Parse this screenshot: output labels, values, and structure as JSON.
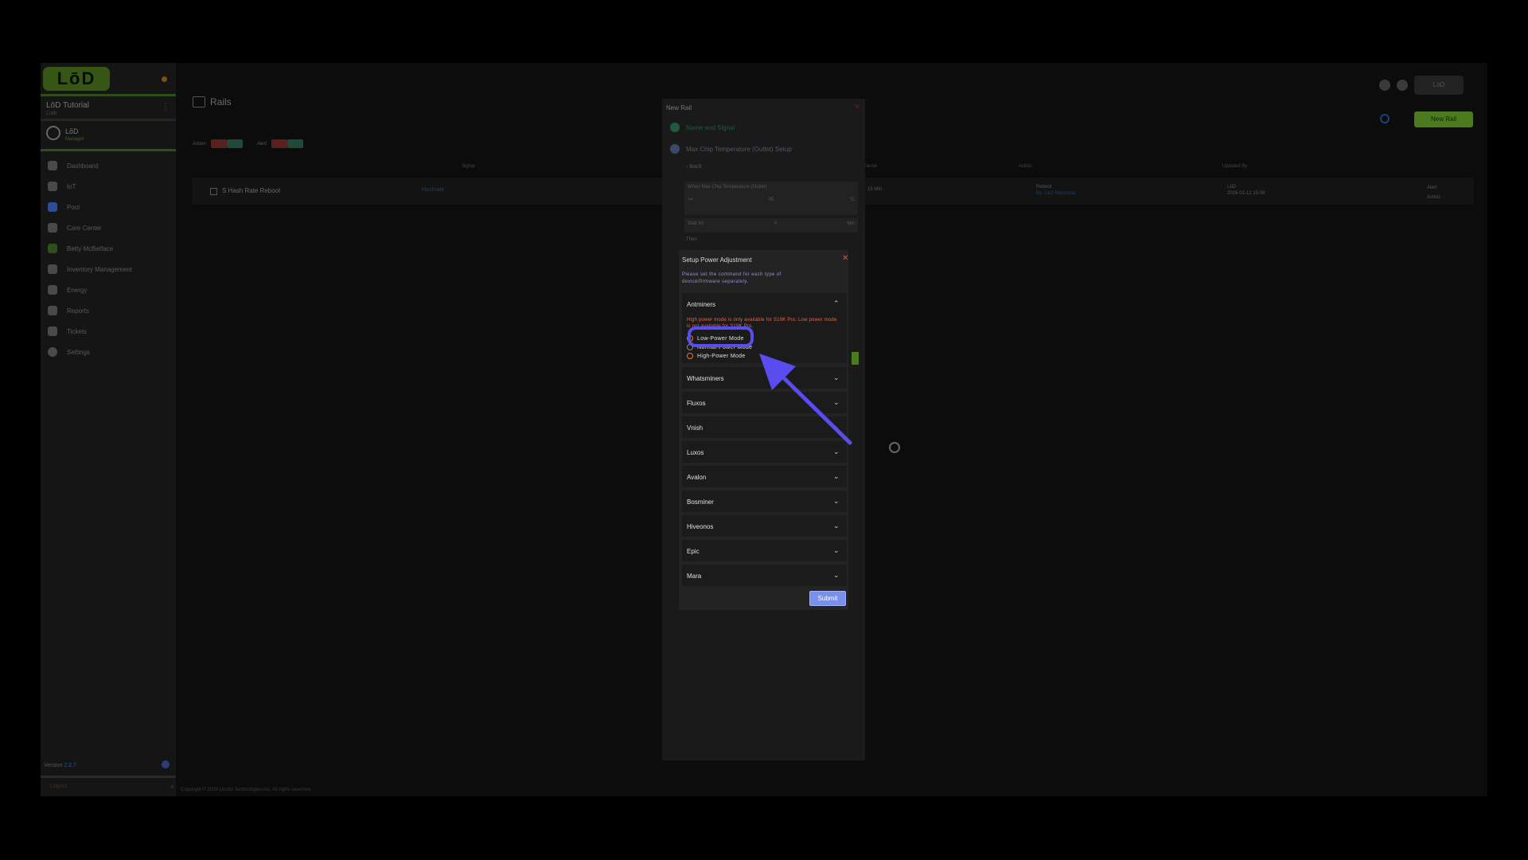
{
  "sidebar": {
    "logo": "LōD",
    "org_name": "LōD Tutorial",
    "org_sub": "Liab",
    "org_menu": "⋮",
    "user_name": "LōD",
    "user_role": "Manager",
    "nav": [
      {
        "label": "Dashboard",
        "icon": "dashboard-icon"
      },
      {
        "label": "IoT",
        "icon": "star-icon"
      },
      {
        "label": "Pool",
        "icon": "pool-icon"
      },
      {
        "label": "Care Center",
        "icon": "care-icon"
      },
      {
        "label": "Betty McBetface",
        "icon": "person-icon"
      },
      {
        "label": "Inventory Management",
        "icon": "inventory-icon"
      },
      {
        "label": "Energy",
        "icon": "bolt-icon"
      },
      {
        "label": "Reports",
        "icon": "reports-icon"
      },
      {
        "label": "Tickets",
        "icon": "ticket-icon"
      },
      {
        "label": "Settings",
        "icon": "gear-icon"
      }
    ],
    "version_label": "Version",
    "version_value": "2.2.7",
    "logout": "Logout",
    "collapse": "‹"
  },
  "topbar": {
    "user": "LōD"
  },
  "main": {
    "title": "Rails",
    "chip_label_1": "Action",
    "chip_label_2": "Alert",
    "new_rail_button": "New Rail",
    "headers": {
      "signal": "Signal",
      "pause": "Pause",
      "action": "Action",
      "updated_by": "Updated By"
    },
    "row": {
      "name": "S Hash Rate Reboot",
      "signal": "Hashrate",
      "mins": "15 Min",
      "action_1": "Reboot",
      "action_2": "By: Last Rebooted",
      "updated_1": "LōD",
      "updated_2": "2026-01-12 15:08",
      "toggle_1": "Alert",
      "toggle_2": "Action"
    },
    "footer": "Copyright © 2026 Litcoin Technologies Inc. All rights reserved."
  },
  "new_rail_modal": {
    "title": "New Rail",
    "close": "✕",
    "step1": "Name and Signal",
    "step2": "Max Chip Temperature (Outlet) Setup",
    "back": "‹  Back",
    "when_label": "When Max Chip Temperature (Outlet)",
    "op": ">=",
    "temp_value": "95",
    "temp_unit": "°C",
    "wait_label": "Wait for",
    "wait_value": "0",
    "wait_unit": "Min",
    "then_label": "Then"
  },
  "power_modal": {
    "title": "Setup Power Adjustment",
    "close": "✕",
    "description": "Please set the command for each type of device/firmware separately.",
    "antminers": {
      "label": "Antminers",
      "warning": "High power mode is only available for S19K Pro. Low power mode is not available for S19K Pro.",
      "options": [
        "Low-Power Mode",
        "Normal-Power Mode",
        "High-Power Mode"
      ]
    },
    "collapsed_sections": [
      "Whatsminers",
      "Fluxos",
      "Vnish",
      "Luxos",
      "Avalon",
      "Bosminer",
      "Hiveonos",
      "Epic",
      "Mara"
    ],
    "submit": "Submit"
  },
  "colors": {
    "accent_green": "#7bbd2f",
    "annotation": "#5a4df0",
    "submit": "#7a8fe8",
    "warning": "#e06a4a",
    "close_red": "#e05050"
  }
}
